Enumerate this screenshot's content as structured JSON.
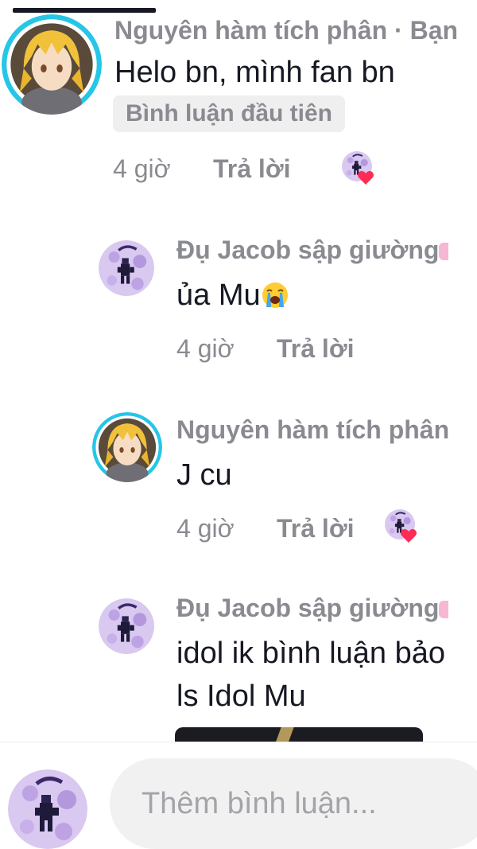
{
  "comments": [
    {
      "author": "Nguyên hàm tích phân · Bạn",
      "text": "Helo bn, mình fan bn",
      "badge": "Bình luận đầu tiên",
      "time": "4 giờ",
      "reply_label": "Trả lời",
      "avatar": "anime-avatar-icon",
      "liked_by_creator": true
    },
    {
      "author": "Đụ Jacob sập giường",
      "text": "ủa Mu",
      "text_emoji": "crying-face-emoji",
      "time": "4 giờ",
      "reply_label": "Trả lời",
      "avatar": "purple-avatar-icon"
    },
    {
      "author": "Nguyên hàm tích phân",
      "text": "J cu",
      "time": "4 giờ",
      "reply_label": "Trả lời",
      "avatar": "anime-avatar-icon",
      "liked_by_creator": true
    },
    {
      "author": "Đụ Jacob sập giường",
      "text_line1": "idol ik bình luận bảo",
      "text_line2": "ls Idol Mu",
      "avatar": "purple-avatar-icon"
    }
  ],
  "composer": {
    "placeholder": "Thêm bình luận...",
    "avatar": "purple-avatar-icon"
  },
  "colors": {
    "text_primary": "#161823",
    "text_secondary": "#8a8b91",
    "avatar_ring": "#25c6e6",
    "like_heart": "#fe2c55",
    "badge_bg": "#efeff0"
  }
}
